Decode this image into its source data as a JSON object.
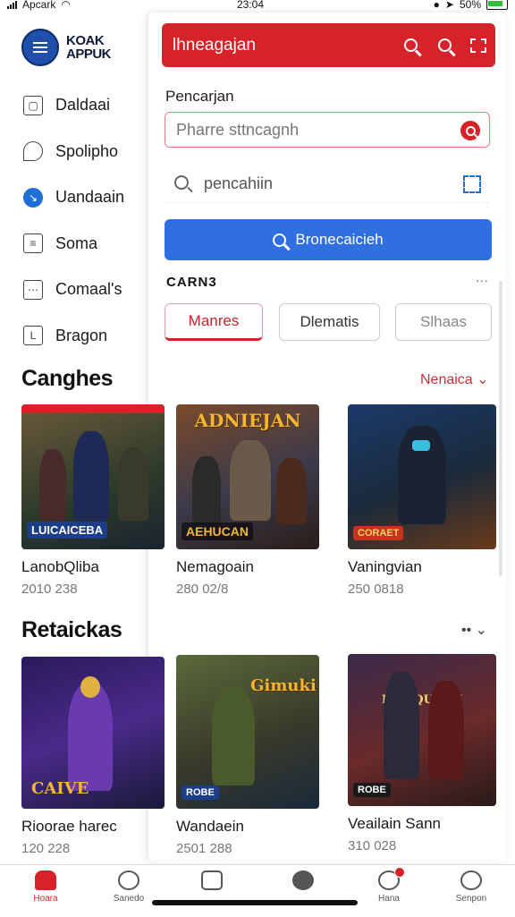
{
  "status": {
    "carrier": "Apcark",
    "time": "23:04",
    "battery": "50%"
  },
  "brand": {
    "line1": "KOAK",
    "line2": "APPUK"
  },
  "sidebar": {
    "items": [
      {
        "label": "Daldaai",
        "icon": "bag-icon"
      },
      {
        "label": "Spolipho",
        "icon": "chat-icon"
      },
      {
        "label": "Uandaain",
        "icon": "compass-icon"
      },
      {
        "label": "Soma",
        "icon": "list-icon"
      },
      {
        "label": "Comaal's",
        "icon": "box-icon"
      },
      {
        "label": "Bragon",
        "icon": "book-icon"
      }
    ]
  },
  "panel": {
    "title": "lhneagajan",
    "section_label": "Pencarjan",
    "search_placeholder": "Pharre sttncagnh",
    "recent_query": "pencahiin",
    "search_button": "Bronecaicieh",
    "categories_title": "CARN3",
    "categories_more": "···",
    "chips": [
      "Manres",
      "Dlematis",
      "Slhaas"
    ]
  },
  "section1": {
    "title": "Canghes",
    "more": "Nenaica",
    "games": [
      {
        "name": "LanobQliba",
        "meta": "2010 238",
        "tag": "LUICAICEBA",
        "logo": ""
      },
      {
        "name": "Nemagoain",
        "meta": "280 02/8",
        "tag": "AEHUCAN",
        "logo": "ADNIEJAN"
      },
      {
        "name": "Vaningvian",
        "meta": "250 0818",
        "tag": "CORAET",
        "logo": ""
      }
    ]
  },
  "section2": {
    "title": "Retaickas",
    "more": "••",
    "games": [
      {
        "name": "Rioorae harec",
        "meta": "120 228",
        "tag": "CAIVE",
        "logo": ""
      },
      {
        "name": "Wandaein",
        "meta": "2501 288",
        "tag": "ROBE",
        "logo": "Gimuki"
      },
      {
        "name": "Veailain Sann",
        "meta": "310 028",
        "tag": "ROBE",
        "logo": "INDIQUKAK"
      }
    ]
  },
  "bottom_nav": [
    {
      "label": "Hoara",
      "icon": "home-icon"
    },
    {
      "label": "Sanedo",
      "icon": "rocket-icon"
    },
    {
      "label": "",
      "icon": "library-icon"
    },
    {
      "label": "",
      "icon": "add-icon"
    },
    {
      "label": "Hana",
      "icon": "heart-icon"
    },
    {
      "label": "Senpon",
      "icon": "support-icon"
    }
  ]
}
